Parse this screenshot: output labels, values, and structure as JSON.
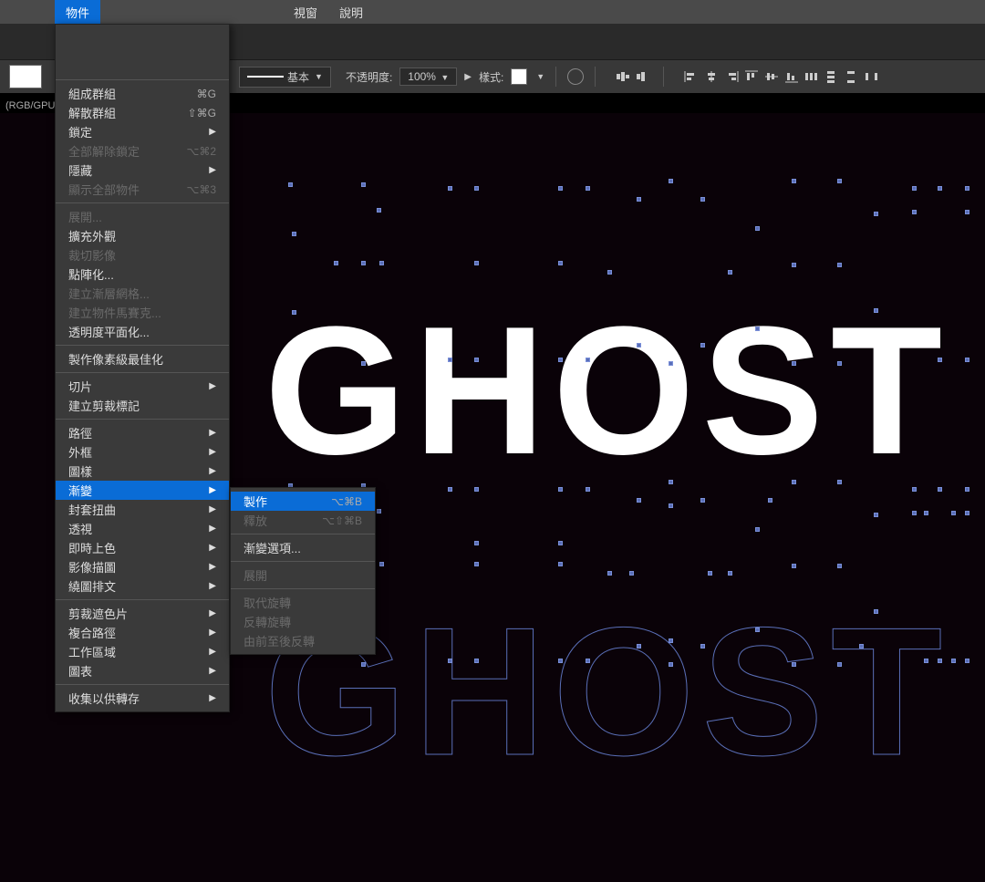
{
  "menubar": {
    "object": "物件",
    "window": "視窗",
    "help": "說明"
  },
  "toolbar": {
    "stroke_style": "基本",
    "opacity_label": "不透明度:",
    "opacity_value": "100%",
    "style_label": "樣式:"
  },
  "doc": {
    "label": "(RGB/GPU"
  },
  "canvas": {
    "text": "GHOST"
  },
  "menu": {
    "group1": [
      {
        "label": "組成群組",
        "shortcut": "⌘G",
        "enabled": true
      },
      {
        "label": "解散群組",
        "shortcut": "⇧⌘G",
        "enabled": true
      },
      {
        "label": "鎖定",
        "submenu": true,
        "enabled": true
      },
      {
        "label": "全部解除鎖定",
        "shortcut": "⌥⌘2",
        "enabled": false
      },
      {
        "label": "隱藏",
        "submenu": true,
        "enabled": true
      },
      {
        "label": "顯示全部物件",
        "shortcut": "⌥⌘3",
        "enabled": false
      }
    ],
    "group2": [
      {
        "label": "展開...",
        "enabled": false
      },
      {
        "label": "擴充外觀",
        "enabled": true
      },
      {
        "label": "裁切影像",
        "enabled": false
      },
      {
        "label": "點陣化...",
        "enabled": true
      },
      {
        "label": "建立漸層網格...",
        "enabled": false
      },
      {
        "label": "建立物件馬賽克...",
        "enabled": false
      },
      {
        "label": "透明度平面化...",
        "enabled": true
      }
    ],
    "group3": [
      {
        "label": "製作像素級最佳化",
        "enabled": true
      }
    ],
    "group4": [
      {
        "label": "切片",
        "submenu": true,
        "enabled": true
      },
      {
        "label": "建立剪裁標記",
        "enabled": true
      }
    ],
    "group5": [
      {
        "label": "路徑",
        "submenu": true,
        "enabled": true
      },
      {
        "label": "外框",
        "submenu": true,
        "enabled": true
      },
      {
        "label": "圖樣",
        "submenu": true,
        "enabled": true
      },
      {
        "label": "漸變",
        "submenu": true,
        "enabled": true,
        "highlighted": true
      },
      {
        "label": "封套扭曲",
        "submenu": true,
        "enabled": true
      },
      {
        "label": "透視",
        "submenu": true,
        "enabled": true
      },
      {
        "label": "即時上色",
        "submenu": true,
        "enabled": true
      },
      {
        "label": "影像描圖",
        "submenu": true,
        "enabled": true
      },
      {
        "label": "繞圖排文",
        "submenu": true,
        "enabled": true
      }
    ],
    "group6": [
      {
        "label": "剪裁遮色片",
        "submenu": true,
        "enabled": true
      },
      {
        "label": "複合路徑",
        "submenu": true,
        "enabled": true
      },
      {
        "label": "工作區域",
        "submenu": true,
        "enabled": true
      },
      {
        "label": "圖表",
        "submenu": true,
        "enabled": true
      }
    ],
    "group7": [
      {
        "label": "收集以供轉存",
        "submenu": true,
        "enabled": true
      }
    ]
  },
  "submenu": {
    "group1": [
      {
        "label": "製作",
        "shortcut": "⌥⌘B",
        "enabled": true,
        "highlighted": true
      },
      {
        "label": "釋放",
        "shortcut": "⌥⇧⌘B",
        "enabled": false
      }
    ],
    "group2": [
      {
        "label": "漸變選項...",
        "enabled": true
      }
    ],
    "group3": [
      {
        "label": "展開",
        "enabled": false
      }
    ],
    "group4": [
      {
        "label": "取代旋轉",
        "enabled": false
      },
      {
        "label": "反轉旋轉",
        "enabled": false
      },
      {
        "label": "由前至後反轉",
        "enabled": false
      }
    ]
  }
}
